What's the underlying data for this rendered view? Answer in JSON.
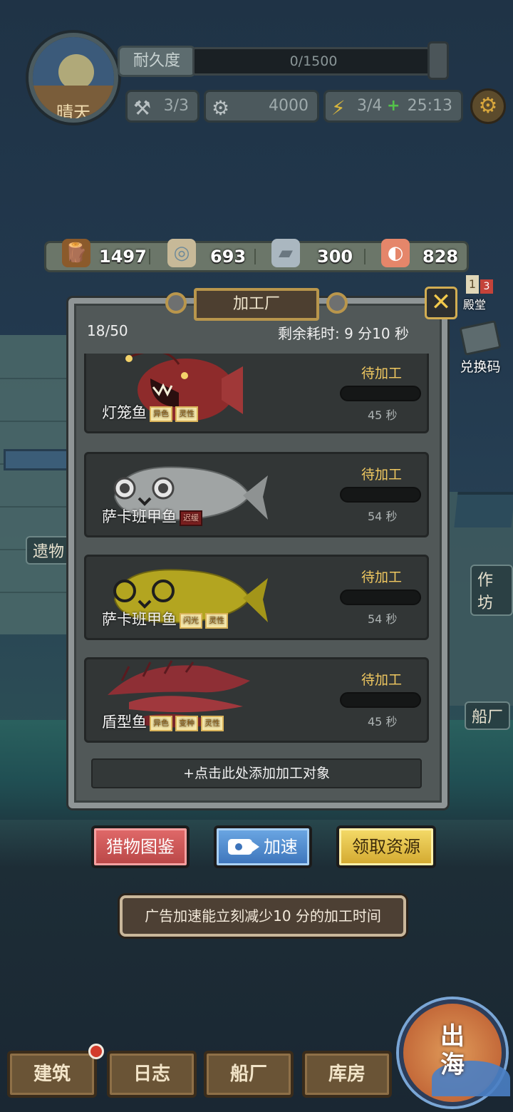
{
  "status": {
    "weather": "晴天",
    "durability_label": "耐久度",
    "durability_value": "0/1500",
    "tools": "3/3",
    "coins": "4000",
    "energy": "3/4",
    "energy_plus": "+",
    "timer": "25:13"
  },
  "resources": [
    {
      "icon": "wood-icon",
      "value": "1497"
    },
    {
      "icon": "rope-icon",
      "value": "693"
    },
    {
      "icon": "iron-ingot-icon",
      "value": "300"
    },
    {
      "icon": "meat-icon",
      "value": "828"
    }
  ],
  "side": {
    "rank_digit": "1",
    "rank_digit2": "3",
    "rank_label": "殿堂",
    "redeem_label": "兑换码",
    "relic_label": "遗物",
    "workshop_label": "作坊",
    "shipyard_label": "船厂"
  },
  "modal": {
    "title": "加工厂",
    "count": "18/50",
    "remaining": "剩余耗时: 9 分10 秒",
    "close_symbol": "✕",
    "items": [
      {
        "name": "灯笼鱼",
        "tags": [
          "异色",
          "灵性"
        ],
        "status": "待加工",
        "time": "45 秒",
        "progress": 0,
        "color": "#8e2b2b"
      },
      {
        "name": "萨卡班甲鱼",
        "tags": [
          "迟缓"
        ],
        "status": "待加工",
        "time": "54 秒",
        "progress": 0,
        "color": "#a0a4a4"
      },
      {
        "name": "萨卡班甲鱼",
        "tags": [
          "闪光",
          "灵性"
        ],
        "status": "待加工",
        "time": "54 秒",
        "progress": 0,
        "color": "#b3a520"
      },
      {
        "name": "盾型鱼",
        "tags": [
          "异色",
          "变种",
          "灵性"
        ],
        "status": "待加工",
        "time": "45 秒",
        "progress": 0,
        "color": "#8e2f35"
      }
    ],
    "add_label": "+点击此处添加加工对象"
  },
  "actions": {
    "catalog": "猎物图鉴",
    "speedup": "加速",
    "collect": "领取资源"
  },
  "tip": "广告加速能立刻减少10 分的加工时间",
  "nav": {
    "build": "建筑",
    "log": "日志",
    "shipyard": "船厂",
    "storage": "库房",
    "sail": "出海"
  }
}
